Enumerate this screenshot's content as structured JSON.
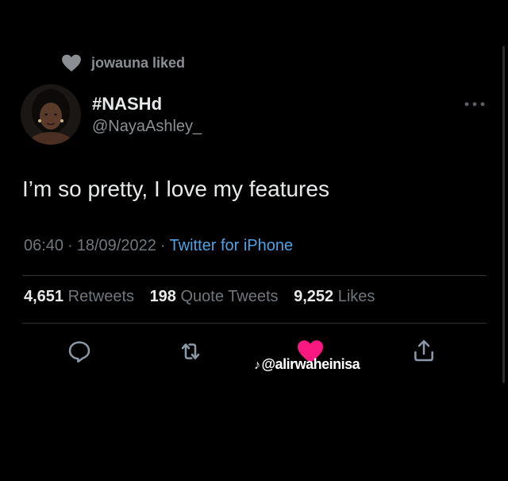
{
  "social_context": {
    "text": "jowauna liked",
    "icon": "heart-icon"
  },
  "author": {
    "display_name": "#NASHd",
    "handle": "@NayaAshley_"
  },
  "tweet": {
    "text": "I’m so pretty, I love my features"
  },
  "meta": {
    "time": "06:40",
    "date": "18/09/2022",
    "source": "Twitter for iPhone",
    "separator": "·"
  },
  "stats": {
    "retweets_count": "4,651",
    "retweets_label": "Retweets",
    "quotes_count": "198",
    "quotes_label": "Quote Tweets",
    "likes_count": "9,252",
    "likes_label": "Likes"
  },
  "actions": {
    "reply_icon": "reply-icon",
    "retweet_icon": "retweet-icon",
    "like_icon": "heart-filled-icon",
    "share_icon": "share-icon",
    "more_icon": "more-icon"
  },
  "watermark": {
    "text": "@alirwaheinisa"
  },
  "colors": {
    "background": "#000000",
    "text_primary": "#e7e9ea",
    "text_secondary": "#71767b",
    "link": "#4fa3e5",
    "like_active": "#f91880"
  }
}
